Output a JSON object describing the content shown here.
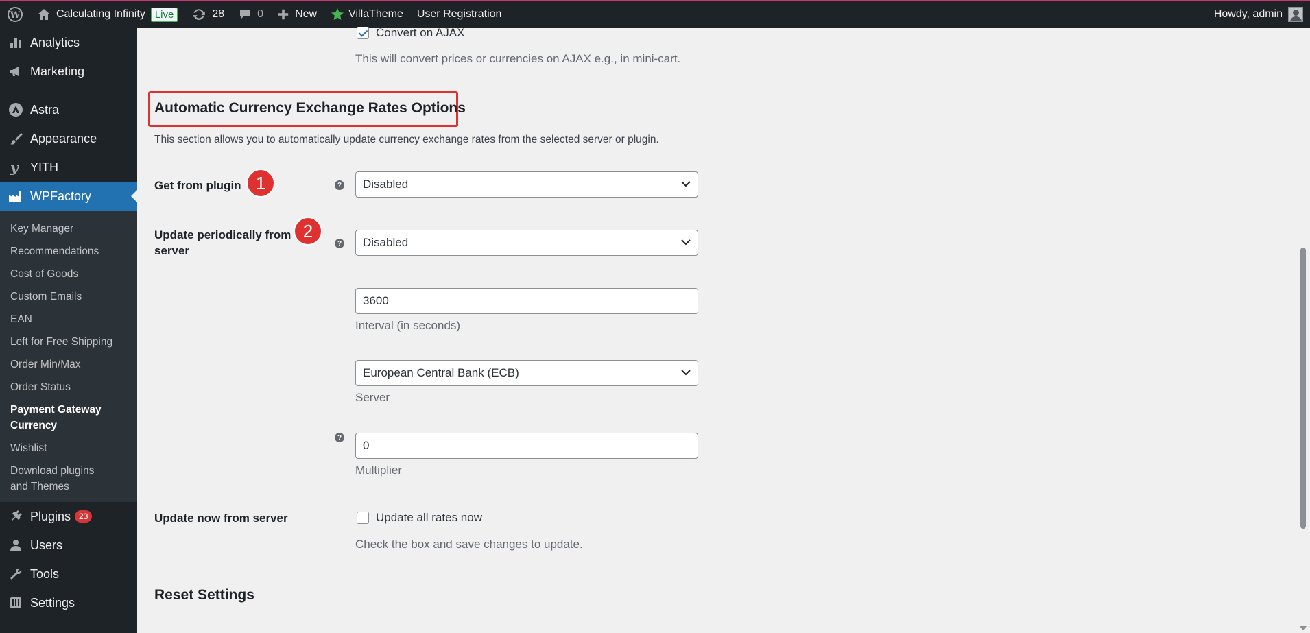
{
  "adminbar": {
    "site_name": "Calculating Infinity",
    "live_badge": "Live",
    "updates_count": "28",
    "comments_count": "0",
    "new_label": "New",
    "villatheme_label": "VillaTheme",
    "user_registration_label": "User Registration",
    "howdy": "Howdy, admin"
  },
  "sidebar": {
    "top_items": [
      {
        "label": "Analytics",
        "icon": "bar-chart-icon"
      },
      {
        "label": "Marketing",
        "icon": "megaphone-icon"
      },
      {
        "label": "Astra",
        "icon": "astra-icon"
      },
      {
        "label": "Appearance",
        "icon": "paintbrush-icon"
      },
      {
        "label": "YITH",
        "icon": "yith-icon"
      },
      {
        "label": "WPFactory",
        "icon": "factory-icon"
      }
    ],
    "sub_items": [
      "Key Manager",
      "Recommendations",
      "Cost of Goods",
      "Custom Emails",
      "EAN",
      "Left for Free Shipping",
      "Order Min/Max",
      "Order Status",
      "Payment Gateway Currency",
      "Wishlist",
      "Download plugins and Themes"
    ],
    "bottom_items": [
      {
        "label": "Plugins",
        "icon": "plug-icon",
        "badge": "23"
      },
      {
        "label": "Users",
        "icon": "user-icon"
      },
      {
        "label": "Tools",
        "icon": "wrench-icon"
      },
      {
        "label": "Settings",
        "icon": "settings-icon"
      }
    ]
  },
  "main": {
    "convert_ajax_label": "Convert on AJAX",
    "convert_ajax_desc": "This will convert prices or currencies on AJAX e.g., in mini-cart.",
    "section_title": "Automatic Currency Exchange Rates Options",
    "section_desc": "This section allows you to automatically update currency exchange rates from the selected server or plugin.",
    "get_from_plugin_label": "Get from plugin",
    "get_from_plugin_value": "Disabled",
    "update_periodically_label": "Update periodically from server",
    "update_periodically_value": "Disabled",
    "interval_value": "3600",
    "interval_desc": "Interval (in seconds)",
    "server_value": "European Central Bank (ECB)",
    "server_desc": "Server",
    "multiplier_value": "0",
    "multiplier_desc": "Multiplier",
    "update_now_label": "Update now from server",
    "update_all_rates_label": "Update all rates now",
    "update_now_desc": "Check the box and save changes to update.",
    "reset_title": "Reset Settings",
    "marker_1": "1",
    "marker_2": "2"
  },
  "colors": {
    "accent": "#2271b1",
    "marker": "#e03131",
    "adminbar_bg": "#1d2327"
  }
}
